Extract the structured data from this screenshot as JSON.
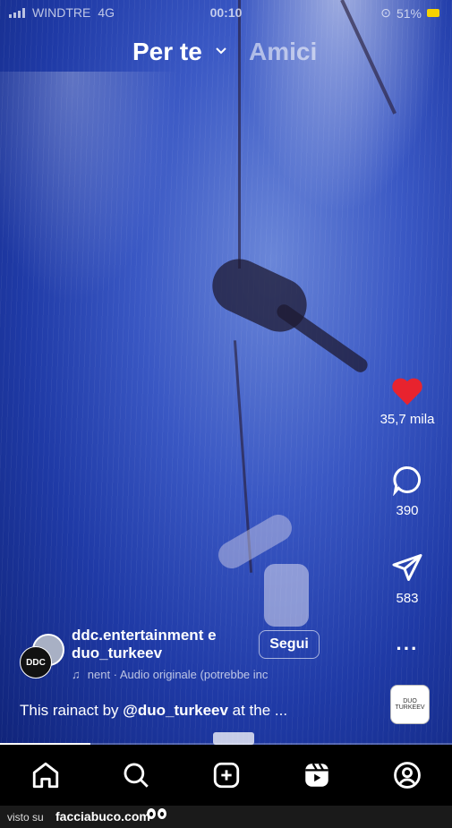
{
  "status": {
    "carrier": "WINDTRE",
    "network": "4G",
    "time": "00:10",
    "battery": "51%"
  },
  "tabs": {
    "active": "Per te",
    "inactive": "Amici"
  },
  "actions": {
    "likes": "35,7 mila",
    "comments": "390",
    "shares": "583"
  },
  "creator": {
    "avatar_text": "DDC",
    "name_line1": "ddc.entertainment e",
    "name_line2": "duo_turkeev",
    "follow_label": "Segui",
    "audio": "nent · Audio originale  (potrebbe inc"
  },
  "caption": {
    "prefix": "This rainact by ",
    "mention": "@duo_turkeev",
    "suffix": " at the ..."
  },
  "music_thumb_text": "DUO TURKEEV",
  "progress": 0.2,
  "footer": {
    "label": "visto su",
    "site": "facciabuco.com"
  },
  "colors": {
    "like_heart": "#e8232e",
    "background_top": "#3a58c4",
    "background_bottom": "#10247a"
  }
}
